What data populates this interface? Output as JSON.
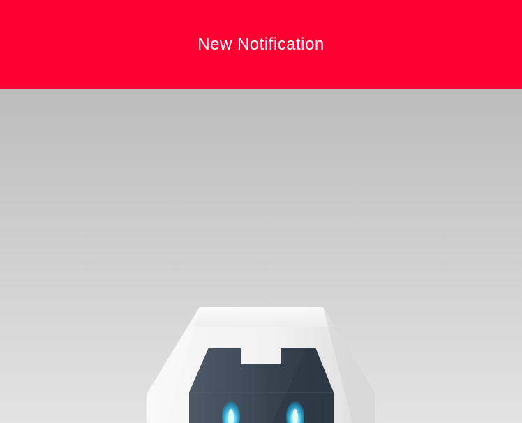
{
  "notification": {
    "text": "New Notification",
    "background_color": "#ff0033"
  },
  "content": {
    "background_color": "#c4c4c4",
    "splash_icon": "cordova-robot-icon"
  }
}
